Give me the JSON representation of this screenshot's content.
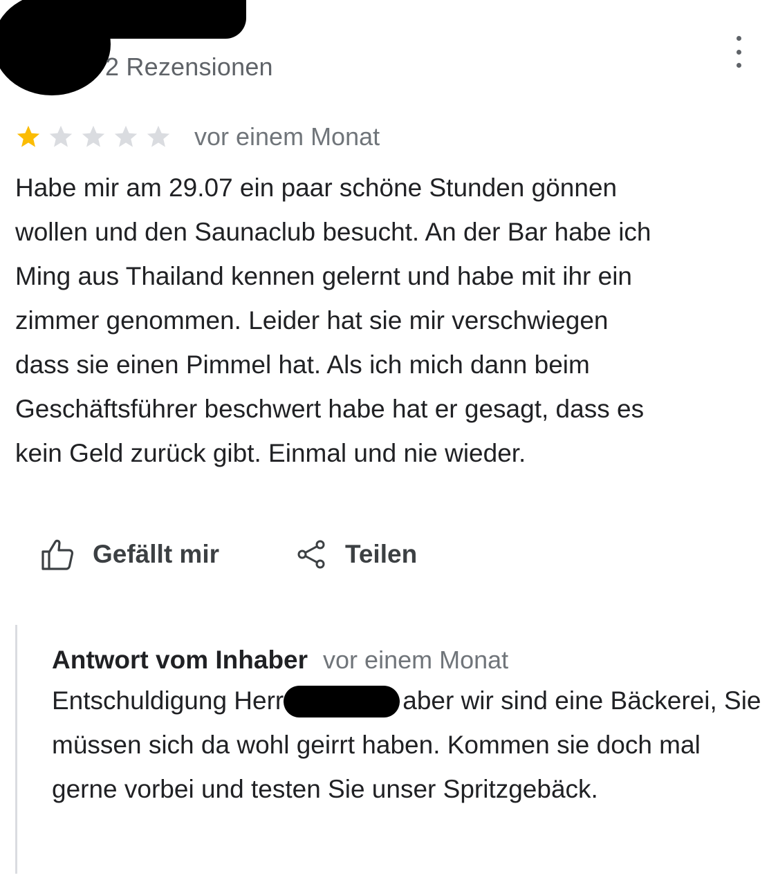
{
  "reviewer": {
    "review_count": "2 Rezensionen"
  },
  "review": {
    "rating": 1,
    "rating_max": 5,
    "star_filled_color": "#fbbc04",
    "star_empty_color": "#dadce0",
    "date": "vor einem Monat",
    "text": "Habe mir am 29.07 ein paar schöne Stunden gönnen\nwollen und den Saunaclub besucht. An der Bar habe ich\nMing aus Thailand kennen gelernt und habe mit ihr ein\nzimmer genommen. Leider hat sie mir verschwiegen\ndass sie einen Pimmel hat. Als ich mich dann beim\nGeschäftsführer beschwert habe hat er gesagt, dass es\nkein Geld zurück gibt. Einmal und nie wieder."
  },
  "actions": {
    "like_label": "Gefällt mir",
    "like_icon": "thumb-up-icon",
    "share_label": "Teilen",
    "share_icon": "share-icon",
    "more_icon": "more-vert-icon"
  },
  "owner_reply": {
    "author": "Antwort vom Inhaber",
    "date": "vor einem Monat",
    "text_before_redaction": "Entschuldigung Herr",
    "text_after_redaction": "aber wir sind eine",
    "text_rest": "Bäckerei, Sie müssen sich da wohl geirrt haben. Kommen sie doch mal gerne vorbei und testen Sie unser Spritzgebäck."
  }
}
